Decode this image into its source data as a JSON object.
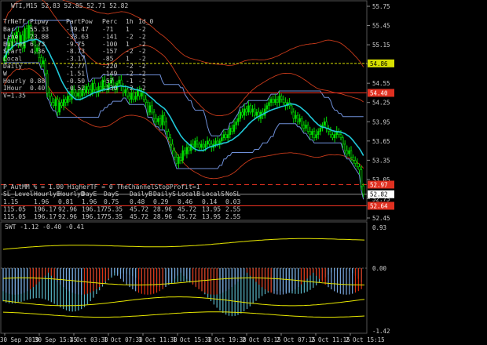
{
  "title": "WTI,M15 52.83 52.85 52.71 52.82",
  "indicator_title": "SWT -1.12 -0.40 -0.41",
  "colors": {
    "background": "#000000",
    "bull": "#00e000",
    "bear": "#00e000",
    "ma": "#20c8d8",
    "channel": "#6f8fd8",
    "env": "#c83a1a",
    "hline_red": "#e03020",
    "hline_yellow": "#d8e000",
    "osc_red": "#e03010",
    "osc_blue": "#7aa8e0",
    "osc_teal": "#5ab8c8",
    "osc_yellow": "#e8e800"
  },
  "info_table": {
    "headers": [
      "TrNeTF",
      "Pipwy",
      "PartPow",
      "Perc",
      "1h",
      "1d_0"
    ],
    "rows": [
      [
        "Bar",
        "55.33",
        "-39.47",
        "-71",
        "1",
        "-2"
      ],
      [
        "Line",
        "23.88",
        "-33.63",
        "-141",
        "-2",
        "-2"
      ],
      [
        "Bullet",
        "6.73",
        "-9.75",
        "-100",
        "1",
        "-2"
      ],
      [
        "Start",
        "4.36",
        "-8.73",
        "-157",
        "-2",
        "-2"
      ],
      [
        "Local",
        "",
        "-3.17",
        "-85",
        "1",
        "-2"
      ],
      [
        "Daily",
        "",
        "-2.77",
        "-220",
        "-2",
        "-2"
      ],
      [
        "W",
        "",
        "-1.51",
        "-149",
        "-2",
        "-2"
      ],
      [
        "Hourly",
        "0.88",
        "-0.50",
        "-57",
        "-1",
        "-2"
      ],
      [
        "IHour",
        "0.40",
        "-0.52",
        "-130",
        "-2",
        "-2"
      ],
      [
        "V=1.35",
        "",
        "",
        "",
        "",
        ""
      ]
    ]
  },
  "bottom_table": {
    "header_line": "P_AutMM_% = 1.00      HigherTF = 0      TheChannelStopProfit=1",
    "headers": [
      "SL_Level",
      "HourlyE",
      "HourlyD",
      "DayE",
      "DayS",
      "DailyB",
      "DailyS",
      "LocalB",
      "LocalS",
      "NoSL"
    ],
    "rows": [
      [
        "1.15",
        "1.96",
        "0.81",
        "1.96",
        "0.75",
        "0.48",
        "0.29",
        "0.46",
        "0.14",
        "0.03"
      ],
      [
        "115.05",
        "196.17",
        "92.96",
        "196.17",
        "75.35",
        "45.72",
        "28.96",
        "45.72",
        "13.95",
        "2.55"
      ],
      [
        "115.05",
        "196.17",
        "92.96",
        "196.17",
        "75.35",
        "45.72",
        "28.96",
        "45.72",
        "13.95",
        "2.55"
      ]
    ]
  },
  "price_scale": [
    "55.75",
    "55.45",
    "55.15",
    "54.85",
    "54.55",
    "54.25",
    "53.95",
    "53.65",
    "53.35",
    "53.05",
    "52.75",
    "52.45"
  ],
  "price_badges": {
    "yellow": "54.86",
    "red_upper": "54.40",
    "red_dash": "52.97",
    "white": "52.82",
    "red_lower": "52.64"
  },
  "osc_scale": [
    "0.93",
    "0.00",
    "-1.42"
  ],
  "time_labels": [
    "30 Sep 2019",
    "30 Sep 15:45",
    "1 Oct 03:30",
    "1 Oct 07:30",
    "1 Oct 11:30",
    "1 Oct 15:30",
    "1 Oct 19:30",
    "2 Oct 03:15",
    "2 Oct 07:15",
    "2 Oct 11:15",
    "2 Oct 15:15"
  ],
  "chart_data": {
    "type": "candlestick",
    "symbol": "WTI",
    "timeframe": "M15",
    "ylim": [
      52.45,
      55.75
    ],
    "close": [
      54.95,
      55.05,
      55.2,
      55.1,
      55.3,
      55.25,
      55.35,
      55.15,
      55.3,
      55.1,
      55.4,
      55.25,
      55.45,
      55.3,
      55.2,
      55.05,
      55.1,
      54.95,
      54.85,
      54.9,
      54.7,
      54.4,
      54.35,
      54.25,
      54.2,
      54.3,
      54.1,
      54.25,
      54.2,
      54.3,
      54.25,
      54.35,
      54.3,
      54.45,
      54.4,
      54.35,
      54.4,
      54.35,
      54.45,
      54.4,
      54.5,
      54.45,
      54.4,
      54.55,
      54.45,
      54.4,
      54.5,
      54.45,
      54.6,
      54.5,
      54.45,
      54.55,
      54.6,
      54.5,
      54.45,
      54.55,
      54.6,
      54.5,
      54.4,
      54.45,
      54.35,
      54.3,
      54.4,
      54.3,
      54.35,
      54.45,
      54.35,
      54.4,
      54.3,
      54.25,
      54.1,
      54.2,
      54.1,
      54.0,
      53.95,
      54.0,
      53.9,
      54.05,
      53.95,
      53.8,
      53.7,
      53.6,
      53.5,
      53.4,
      53.3,
      53.4,
      53.35,
      53.5,
      53.45,
      53.55,
      53.5,
      53.6,
      53.55,
      53.65,
      53.6,
      53.55,
      53.6,
      53.55,
      53.6,
      53.65,
      53.6,
      53.55,
      53.6,
      53.65,
      53.6,
      53.65,
      53.7,
      53.75,
      53.7,
      53.75,
      53.85,
      53.8,
      53.9,
      53.95,
      54.0,
      54.1,
      54.05,
      54.15,
      54.1,
      54.2,
      54.1,
      54.15,
      54.05,
      54.1,
      54.0,
      54.1,
      54.05,
      54.15,
      54.2,
      54.25,
      54.3,
      54.25,
      54.3,
      54.25,
      54.35,
      54.3,
      54.25,
      54.2,
      54.25,
      54.2,
      54.1,
      54.0,
      54.05,
      53.95,
      54.0,
      53.9,
      53.85,
      53.9,
      53.8,
      53.75,
      53.8,
      53.7,
      53.75,
      53.8,
      53.85,
      53.9,
      53.95,
      53.85,
      53.8,
      53.75,
      53.7,
      53.75,
      53.8,
      53.75,
      53.7,
      53.6,
      53.5,
      53.45,
      53.5,
      53.4,
      53.35,
      53.3,
      53.25,
      53.2,
      52.95,
      52.82
    ]
  }
}
